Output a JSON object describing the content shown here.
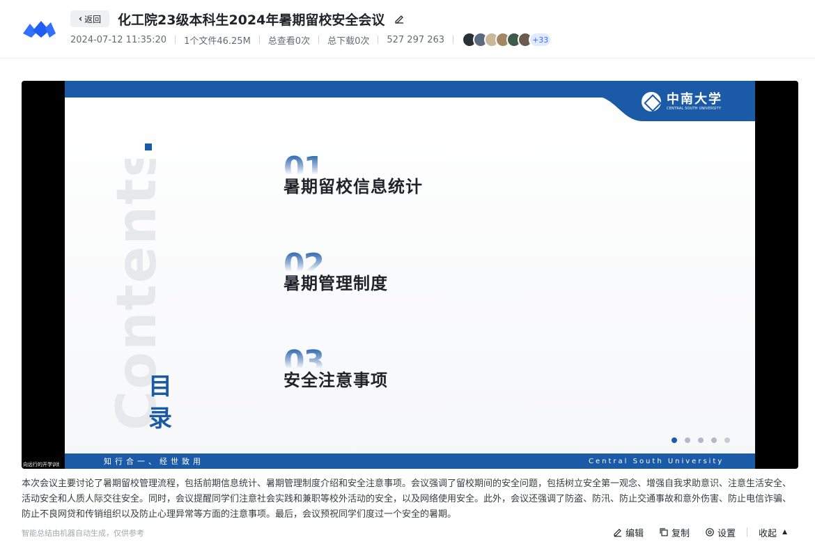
{
  "header": {
    "back_label": "返回",
    "title": "化工院23级本科生2024年暑期留校安全会议",
    "meta": {
      "datetime": "2024-07-12 11:35:20",
      "files": "1个文件46.25M",
      "views": "总查看0次",
      "downloads": "总下载0次",
      "code": "527 297 263",
      "more_viewers": "+33"
    }
  },
  "slide": {
    "university_cn": "中南大学",
    "university_en_small": "CENTRAL SOUTH UNIVERSITY",
    "watermark": "Contents",
    "mulu": "目录",
    "items": [
      {
        "num": "01",
        "text": "暑期留校信息统计"
      },
      {
        "num": "02",
        "text": "暑期管理制度"
      },
      {
        "num": "03",
        "text": "安全注意事项"
      }
    ],
    "motto": "知行合一、经世致用",
    "univ_en": "Central South University",
    "small_tag": "向远行的开学训练"
  },
  "summary": {
    "text": "本次会议主要讨论了暑期留校管理流程，包括前期信息统计、暑期管理制度介绍和安全注意事项。会议强调了留校期间的安全问题，包括树立安全第一观念、增强自我求助意识、注意生活安全、活动安全和人质人际交往安全。同时，会议提醒同学们注意社会实践和兼职等校外活动的安全，以及网络使用安全。此外，会议还强调了防盗、防汛、防止交通事故和意外伤害、防止电信诈骗、防止不良网贷和传销组织以及防止心理异常等方面的注意事项。最后，会议预祝同学们度过一个安全的暑期。",
    "disclaimer": "智能总结由机器自动生成，仅供参考"
  },
  "actions": {
    "edit": "编辑",
    "copy": "复制",
    "settings": "设置",
    "collapse": "收起"
  },
  "colors": {
    "brand_blue": "#3370ff",
    "csu_blue": "#1b5aa6"
  },
  "icons": {
    "logo": "feishu-logo",
    "back": "chevron-left-icon",
    "edit": "pencil-icon",
    "copy": "copy-icon",
    "settings": "gear-icon",
    "collapse": "caret-up-icon"
  }
}
